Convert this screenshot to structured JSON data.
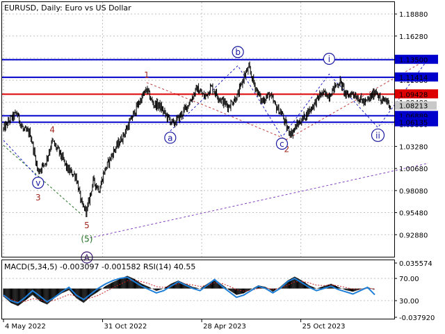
{
  "header": {
    "title": "EURUSD, Daily:  Euro vs US Dollar",
    "indicator_label": "MACD(5,34,5) -0.003097 -0.001582 RSI(14) 40.55"
  },
  "colors": {
    "background": "#ffffff",
    "grid": "#c0c0c0",
    "candles": "#000000",
    "support_resistance": "#0000cc",
    "key_level": "#dd0000",
    "wave_labels_red": "#a0281e",
    "wave_labels_blue": "#1818a0",
    "wave_label_green": "#207020",
    "wave_label_purple": "#3c1470",
    "trend_dotted_red": "#c04040",
    "trend_dotted_blue": "#2020c0",
    "trend_dotted_purple": "#8040c0",
    "rsi_line": "#1e7fd8",
    "macd_signal": "#cc2020"
  },
  "chart_data": [
    {
      "type": "line",
      "title": "EURUSD, Daily:  Euro vs US Dollar",
      "ylim": [
        0.9028,
        1.2028
      ],
      "y_ticks": [
        "1.18880",
        "1.16280",
        "1.13680",
        "1.11080",
        "1.08480",
        "1.05880",
        "1.03280",
        "1.00680",
        "0.98080",
        "0.95480",
        "0.92880"
      ],
      "x_ticks": [
        "4 May 2022",
        "31 Oct 2022",
        "28 Apr 2023",
        "25 Oct 2023"
      ],
      "x_tick_index": [
        0,
        126,
        252,
        378
      ],
      "price_path": [
        [
          0,
          1.053
        ],
        [
          9,
          1.065
        ],
        [
          17,
          1.072
        ],
        [
          25,
          1.052
        ],
        [
          34,
          1.048
        ],
        [
          44,
          1.003
        ],
        [
          54,
          1.015
        ],
        [
          62,
          1.039
        ],
        [
          72,
          1.024
        ],
        [
          82,
          1.005
        ],
        [
          92,
          0.998
        ],
        [
          100,
          0.962
        ],
        [
          106,
          0.957
        ],
        [
          114,
          0.992
        ],
        [
          122,
          0.982
        ],
        [
          128,
          1.003
        ],
        [
          140,
          1.027
        ],
        [
          152,
          1.045
        ],
        [
          162,
          1.064
        ],
        [
          172,
          1.084
        ],
        [
          182,
          1.1
        ],
        [
          190,
          1.083
        ],
        [
          198,
          1.081
        ],
        [
          206,
          1.07
        ],
        [
          216,
          1.059
        ],
        [
          226,
          1.07
        ],
        [
          236,
          1.084
        ],
        [
          246,
          1.101
        ],
        [
          256,
          1.091
        ],
        [
          264,
          1.103
        ],
        [
          276,
          1.088
        ],
        [
          286,
          1.08
        ],
        [
          298,
          1.093
        ],
        [
          306,
          1.116
        ],
        [
          312,
          1.125
        ],
        [
          318,
          1.108
        ],
        [
          328,
          1.086
        ],
        [
          338,
          1.094
        ],
        [
          346,
          1.08
        ],
        [
          354,
          1.071
        ],
        [
          360,
          1.055
        ],
        [
          366,
          1.048
        ],
        [
          374,
          1.059
        ],
        [
          382,
          1.067
        ],
        [
          392,
          1.079
        ],
        [
          404,
          1.095
        ],
        [
          414,
          1.093
        ],
        [
          422,
          1.104
        ],
        [
          428,
          1.109
        ],
        [
          436,
          1.092
        ],
        [
          444,
          1.096
        ],
        [
          452,
          1.089
        ],
        [
          460,
          1.084
        ],
        [
          468,
          1.092
        ],
        [
          474,
          1.099
        ],
        [
          480,
          1.085
        ],
        [
          486,
          1.088
        ],
        [
          492,
          1.081
        ]
      ],
      "levels": [
        {
          "value": 1.135,
          "label": "1.13500",
          "color": "#0000cc"
        },
        {
          "value": 1.11414,
          "label": "1.11414",
          "color": "#0000cc"
        },
        {
          "value": 1.09428,
          "label": "1.09428",
          "color": "#dd0000"
        },
        {
          "value": 1.06889,
          "label": "1.06889",
          "color": "#0000cc"
        },
        {
          "value": 1.06135,
          "label": "1.06135",
          "color": "#0000cc"
        }
      ],
      "current_price_tag": "1.08213",
      "wave_labels": [
        {
          "text": "1",
          "style": "plain",
          "color": "#a0281e",
          "index": 182,
          "value": 1.117
        },
        {
          "text": "2",
          "style": "plain",
          "color": "#a0281e",
          "index": 360,
          "value": 1.03
        },
        {
          "text": "3",
          "style": "plain",
          "color": "#a0281e",
          "index": 44,
          "value": 0.973
        },
        {
          "text": "4",
          "style": "plain",
          "color": "#a0281e",
          "index": 62,
          "value": 1.053
        },
        {
          "text": "5",
          "style": "plain",
          "color": "#a0281e",
          "index": 106,
          "value": 0.94
        },
        {
          "text": "(5)",
          "style": "plain",
          "color": "#207020",
          "index": 106,
          "value": 0.924
        },
        {
          "text": "A",
          "style": "circle",
          "color": "#3c1470",
          "index": 106,
          "value": 0.902
        },
        {
          "text": "v",
          "style": "circle",
          "color": "#1818a0",
          "index": 44,
          "value": 0.99
        },
        {
          "text": "a",
          "style": "circle",
          "color": "#1818a0",
          "index": 212,
          "value": 1.043
        },
        {
          "text": "b",
          "style": "circle",
          "color": "#1818a0",
          "index": 298,
          "value": 1.144
        },
        {
          "text": "c",
          "style": "circle",
          "color": "#1818a0",
          "index": 354,
          "value": 1.036
        },
        {
          "text": "i",
          "style": "circle",
          "color": "#1818a0",
          "index": 414,
          "value": 1.136
        },
        {
          "text": "ii",
          "style": "circle",
          "color": "#1818a0",
          "index": 476,
          "value": 1.046
        }
      ],
      "trend_lines": [
        {
          "points": [
            [
              0,
              1.034
            ],
            [
              100,
              0.952
            ]
          ],
          "color": "#207020"
        },
        {
          "points": [
            [
              0,
              1.04
            ],
            [
              44,
              0.996
            ]
          ],
          "color": "#2020c0"
        },
        {
          "points": [
            [
              182,
              1.108
            ],
            [
              264,
              1.078
            ],
            [
              360,
              1.041
            ],
            [
              540,
              1.136
            ]
          ],
          "color": "#c04040"
        },
        {
          "points": [
            [
              212,
              1.051
            ],
            [
              298,
              1.128
            ],
            [
              354,
              1.044
            ]
          ],
          "color": "#2020c0"
        },
        {
          "points": [
            [
              356,
              1.046
            ],
            [
              414,
              1.118
            ],
            [
              476,
              1.055
            ],
            [
              540,
              1.136
            ]
          ],
          "color": "#2020c0"
        },
        {
          "points": [
            [
              110,
              0.925
            ],
            [
              540,
              1.013
            ]
          ],
          "color": "#8040c0"
        }
      ]
    },
    {
      "type": "line",
      "title": "MACD(5,34,5) -0.003097 -0.001582 RSI(14) 40.55",
      "ylim": [
        -0.03792,
        0.035574
      ],
      "y_ticks": [
        "0.035574",
        "70.00",
        "30.00",
        "-0.037920"
      ],
      "series": [
        {
          "name": "MACD",
          "values": [
            -0.01,
            -0.018,
            -0.022,
            -0.015,
            -0.008,
            -0.016,
            -0.02,
            -0.012,
            -0.006,
            -0.002,
            -0.012,
            -0.018,
            -0.01,
            -0.004,
            0.003,
            0.008,
            0.012,
            0.016,
            0.012,
            0.006,
            0.002,
            -0.003,
            0.0,
            0.006,
            0.01,
            0.006,
            0.002,
            0.0,
            0.006,
            0.012,
            0.005,
            -0.002,
            -0.008,
            -0.006,
            -0.001,
            0.004,
            0.002,
            -0.004,
            0.002,
            0.01,
            0.015,
            0.01,
            0.004,
            0.0,
            0.003,
            0.006,
            0.002,
            -0.002,
            -0.004,
            -0.001,
            0.002,
            -0.002
          ]
        },
        {
          "name": "RSI(14)",
          "values": [
            40,
            30,
            26,
            36,
            48,
            38,
            28,
            36,
            46,
            54,
            40,
            32,
            42,
            52,
            60,
            66,
            70,
            72,
            64,
            56,
            50,
            44,
            48,
            56,
            64,
            58,
            52,
            48,
            58,
            68,
            56,
            46,
            36,
            40,
            48,
            56,
            52,
            44,
            52,
            64,
            70,
            62,
            54,
            48,
            52,
            56,
            50,
            46,
            42,
            48,
            54,
            40.55
          ]
        }
      ]
    }
  ]
}
